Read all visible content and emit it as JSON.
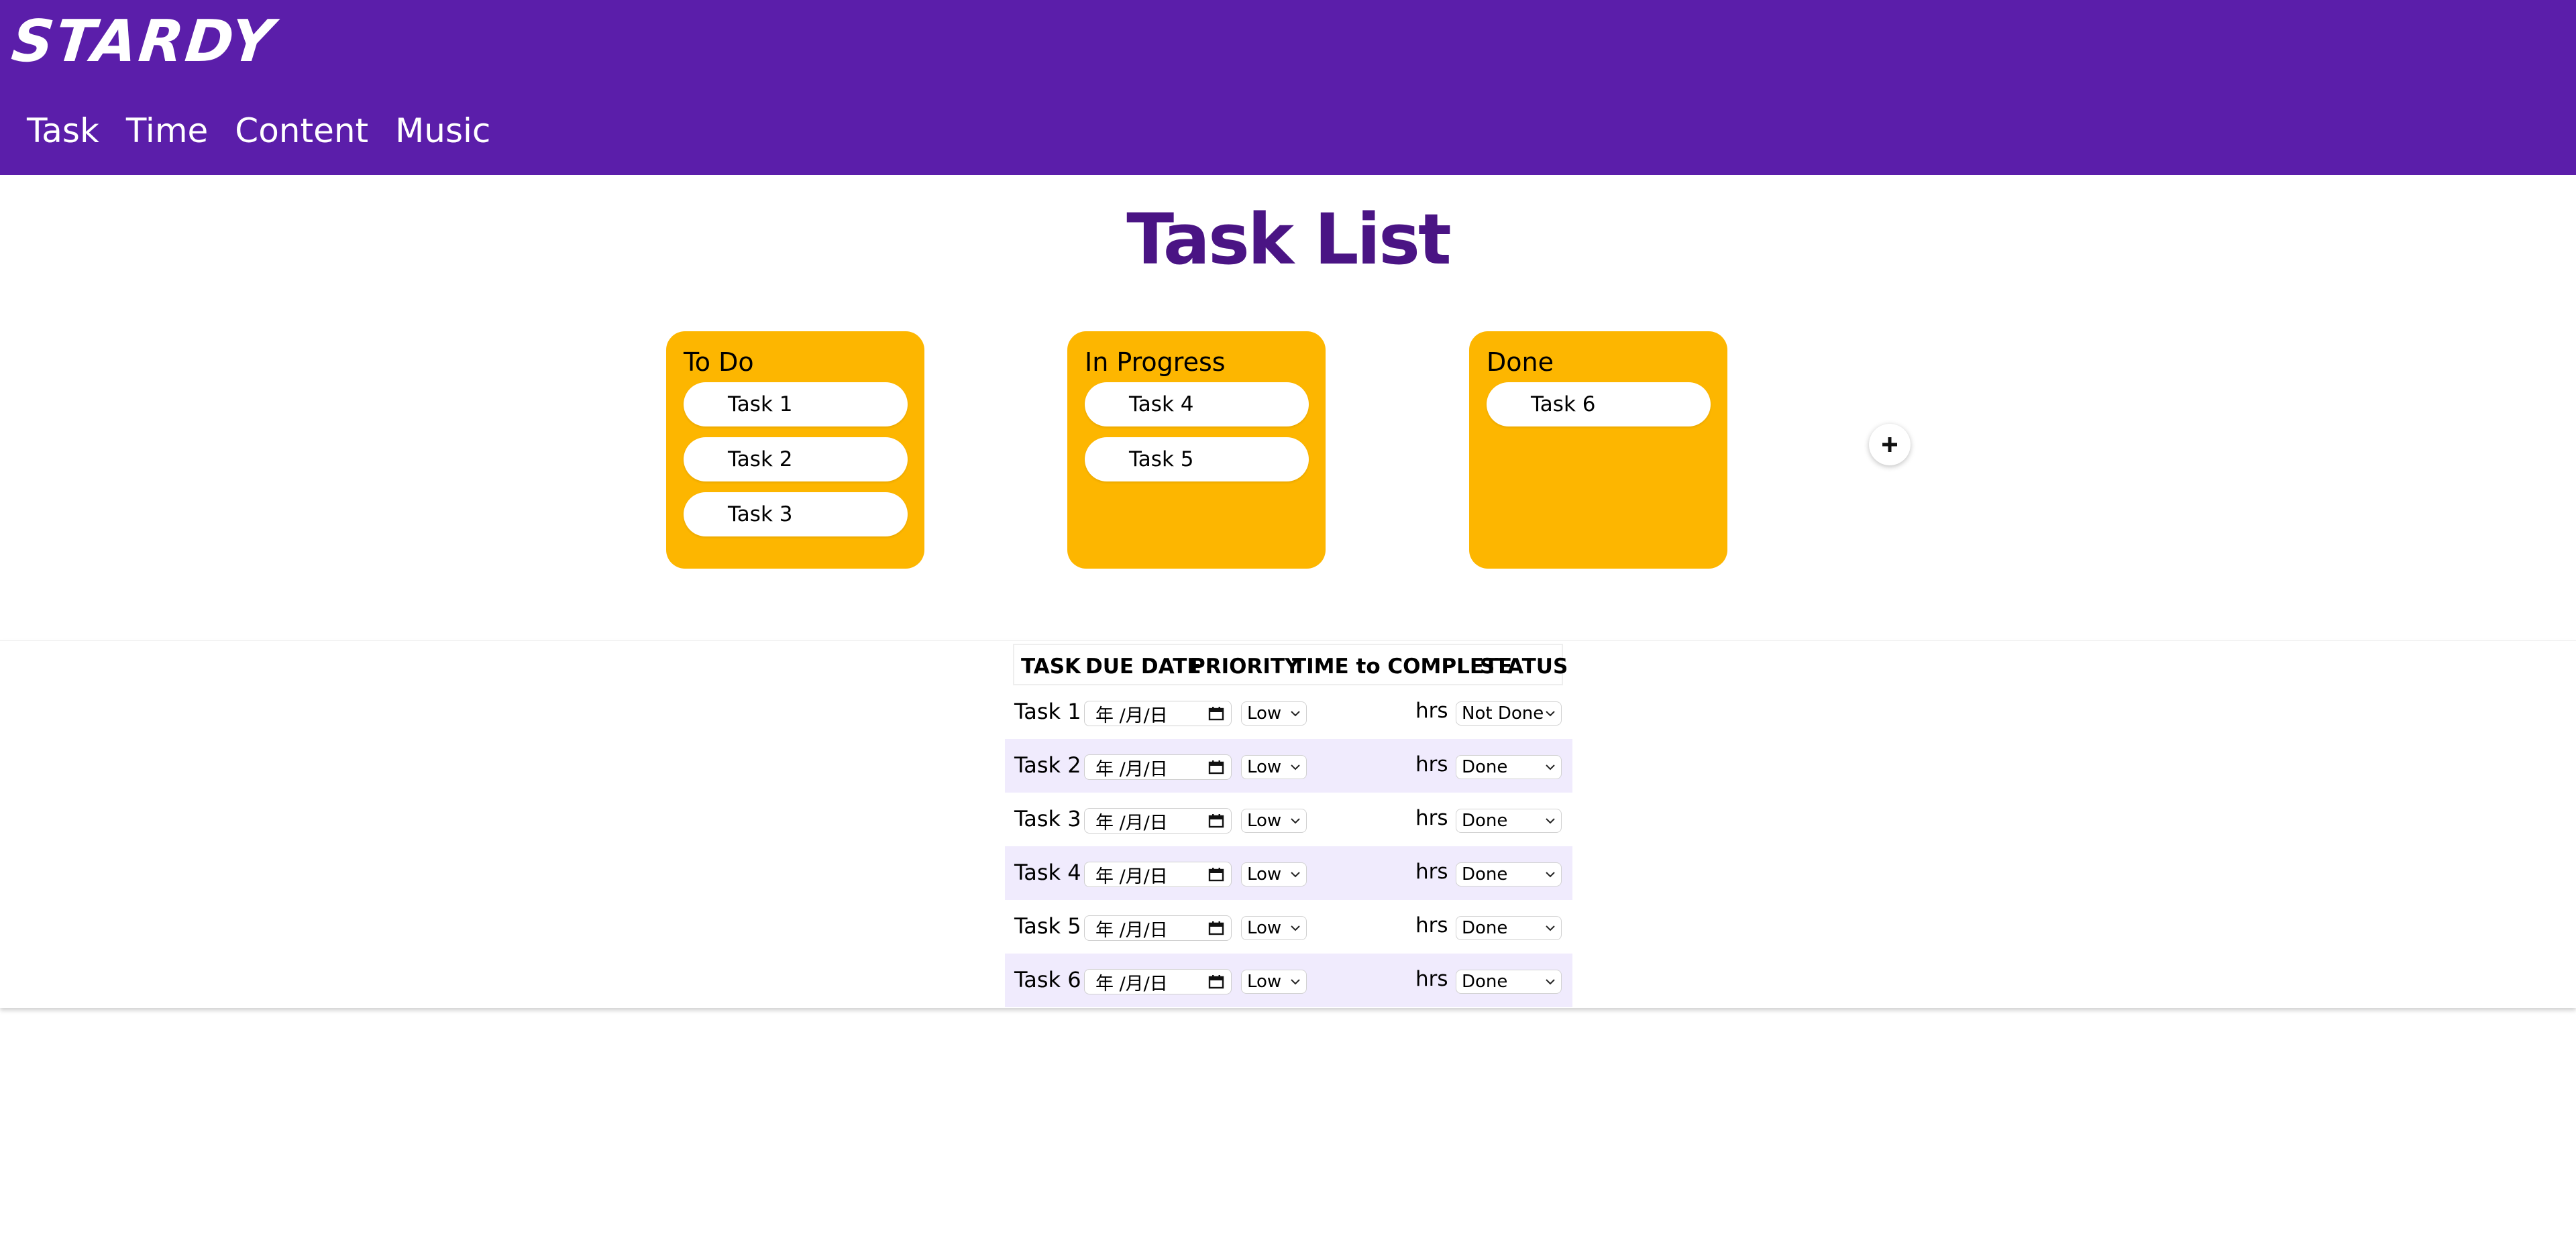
{
  "app": {
    "logo": "STARDY"
  },
  "nav": {
    "items": [
      {
        "label": "Task"
      },
      {
        "label": "Time"
      },
      {
        "label": "Content"
      },
      {
        "label": "Music"
      }
    ]
  },
  "page": {
    "title": "Task List"
  },
  "board": {
    "columns": [
      {
        "title": "To Do",
        "tasks": [
          "Task 1",
          "Task 2",
          "Task 3"
        ]
      },
      {
        "title": "In Progress",
        "tasks": [
          "Task 4",
          "Task 5"
        ]
      },
      {
        "title": "Done",
        "tasks": [
          "Task 6"
        ]
      }
    ],
    "add_icon": "plus-icon"
  },
  "table": {
    "headers": {
      "task": "TASK",
      "due_date": "DUE DATE",
      "priority": "PRIORITY",
      "time": "TIME to COMPLETE",
      "status": "STATUS"
    },
    "date_placeholder": "年 /月/日",
    "hours_unit": "hrs",
    "rows": [
      {
        "task": "Task 1",
        "priority": "Low",
        "status": "Not Done"
      },
      {
        "task": "Task 2",
        "priority": "Low",
        "status": "Done"
      },
      {
        "task": "Task 3",
        "priority": "Low",
        "status": "Done"
      },
      {
        "task": "Task 4",
        "priority": "Low",
        "status": "Done"
      },
      {
        "task": "Task 5",
        "priority": "Low",
        "status": "Done"
      },
      {
        "task": "Task 6",
        "priority": "Low",
        "status": "Done"
      }
    ]
  },
  "colors": {
    "header_bg": "#5b1eaa",
    "title": "#4a1484",
    "column_bg": "#fdb600",
    "row_alt": "#f0ebfd"
  }
}
